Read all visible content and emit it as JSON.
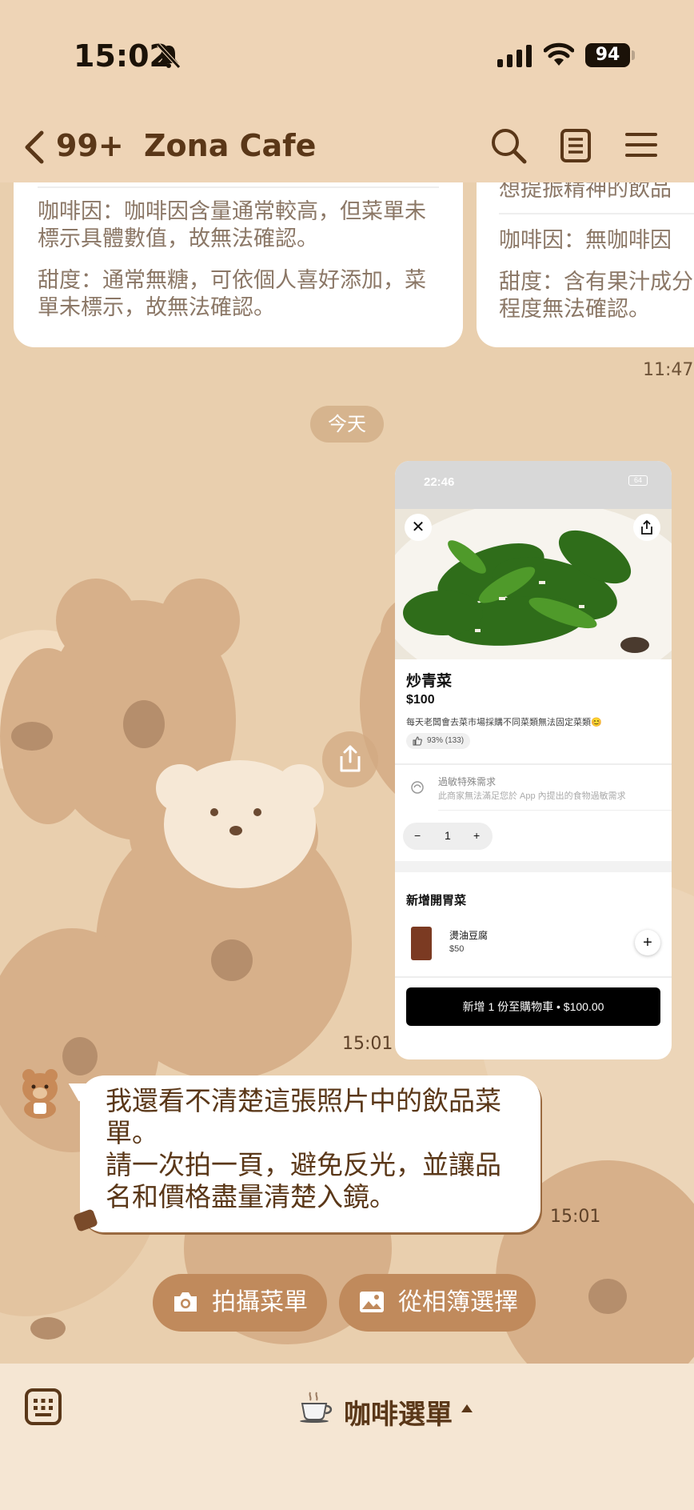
{
  "status_bar": {
    "time": "15:02",
    "battery": "94"
  },
  "header": {
    "back_count": "99+",
    "title": "Zona Cafe"
  },
  "cards": {
    "left": {
      "caffeine": "咖啡因：咖啡因含量通常較高，但菜單未標示具體數值，故無法確認。",
      "sweetness": "甜度：通常無糖，可依個人喜好添加，菜單未標示，故無法確認。"
    },
    "right": {
      "partial_heading": "想提振精神的飲品",
      "caffeine": "咖啡因：無咖啡因",
      "sweetness": "甜度：含有果汁成分程度無法確認。"
    }
  },
  "time_1147": "11:47",
  "date_pill": "今天",
  "screenshot": {
    "status_time": "22:46",
    "battery": "64",
    "dish_name": "炒青菜",
    "price": "$100",
    "description": "每天老闆會去菜市場採購不同菜類無法固定菜類😊",
    "rating": "93% (133)",
    "allergy_title": "過敏特殊需求",
    "allergy_sub": "此商家無法滿足您於 App 內提出的食物過敏需求",
    "quantity": "1",
    "addon_title": "新增開胃菜",
    "addon_name": "燙油豆腐",
    "addon_price": "$50",
    "cart_button": "新增 1 份至購物車 • $100.00"
  },
  "time_1501_image": "15:01",
  "bot_message": {
    "line1": "我還看不清楚這張照片中的飲品菜單。",
    "line2": "請一次拍一頁，避免反光，並讓品名和價格盡量清楚入鏡。",
    "time": "15:01"
  },
  "quick_replies": {
    "camera": "拍攝菜單",
    "album": "從相簿選擇"
  },
  "bottom_bar": {
    "rich_menu_label": "咖啡選單"
  },
  "colors": {
    "background": "#e9cfae",
    "header": "#eed4b6",
    "accent": "#c08a5c",
    "text": "#5a3718"
  }
}
